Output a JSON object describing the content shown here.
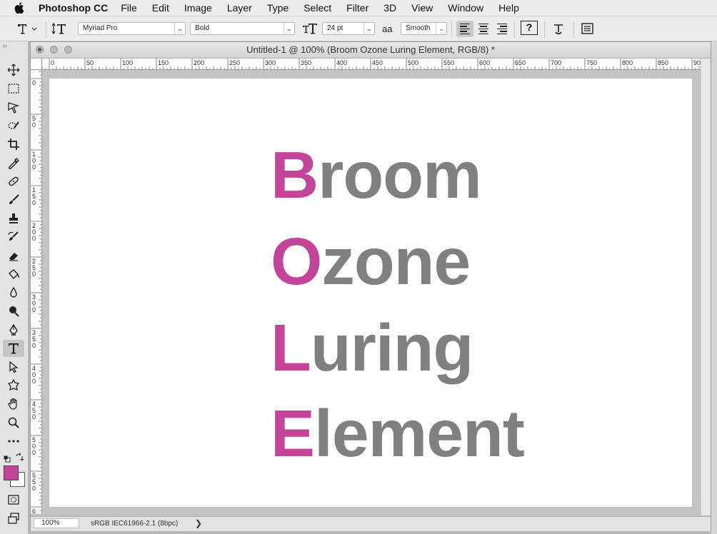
{
  "menubar": {
    "app_name": "Photoshop CC",
    "items": [
      "File",
      "Edit",
      "Image",
      "Layer",
      "Type",
      "Select",
      "Filter",
      "3D",
      "View",
      "Window",
      "Help"
    ]
  },
  "options": {
    "font_family": "Myriad Pro",
    "font_style": "Bold",
    "font_size": "24 pt",
    "antialias_label": "aa",
    "antialias": "Smooth",
    "help_glyph": "?"
  },
  "tools": [
    {
      "name": "move-tool",
      "icon": "move-icon"
    },
    {
      "name": "marquee-tool",
      "icon": "marquee-icon"
    },
    {
      "name": "lasso-tool",
      "icon": "lasso-icon"
    },
    {
      "name": "quick-select-tool",
      "icon": "quick-select-icon"
    },
    {
      "name": "crop-tool",
      "icon": "crop-icon"
    },
    {
      "name": "eyedropper-tool",
      "icon": "eyedropper-icon"
    },
    {
      "name": "healing-tool",
      "icon": "bandage-icon"
    },
    {
      "name": "brush-tool",
      "icon": "brush-icon"
    },
    {
      "name": "stamp-tool",
      "icon": "stamp-icon"
    },
    {
      "name": "history-brush-tool",
      "icon": "history-brush-icon"
    },
    {
      "name": "eraser-tool",
      "icon": "eraser-icon"
    },
    {
      "name": "paint-bucket-tool",
      "icon": "bucket-icon"
    },
    {
      "name": "blur-tool",
      "icon": "blur-icon"
    },
    {
      "name": "dodge-tool",
      "icon": "dodge-icon"
    },
    {
      "name": "pen-tool",
      "icon": "pen-icon"
    },
    {
      "name": "type-tool",
      "icon": "type-icon",
      "active": true
    },
    {
      "name": "path-select-tool",
      "icon": "arrow-icon"
    },
    {
      "name": "shape-tool",
      "icon": "shape-icon"
    },
    {
      "name": "hand-tool",
      "icon": "hand-icon"
    },
    {
      "name": "zoom-tool",
      "icon": "zoom-icon"
    },
    {
      "name": "more-tools",
      "icon": "ellipsis-icon"
    }
  ],
  "colors": {
    "foreground": "#c4449a",
    "background": "#ffffff",
    "letter_gray": "#808080",
    "letter_accent": "#c4449a"
  },
  "document": {
    "title": "Untitled-1 @ 100% (Broom Ozone Luring Element, RGB/8) *",
    "zoom": "100%",
    "profile": "sRGB IEC61966-2.1 (8bpc)",
    "status_arrow": "❯",
    "ruler_h_labels": [
      "0",
      "50",
      "100",
      "150",
      "200",
      "250",
      "300",
      "350",
      "400",
      "450",
      "500",
      "550",
      "600",
      "650",
      "700",
      "750",
      "800",
      "850",
      "90"
    ],
    "ruler_v_labels": [
      "0",
      "5\n0",
      "1\n0\n0",
      "1\n5\n0",
      "2\n0\n0",
      "2\n5\n0",
      "3\n0\n0",
      "3\n5\n0",
      "4\n0\n0",
      "4\n5\n0",
      "5\n0\n0",
      "5\n5\n0",
      "6"
    ],
    "lines": [
      {
        "initial": "B",
        "rest": "room"
      },
      {
        "initial": "O",
        "rest": "zone"
      },
      {
        "initial": "L",
        "rest": "uring"
      },
      {
        "initial": "E",
        "rest": "lement"
      }
    ]
  }
}
